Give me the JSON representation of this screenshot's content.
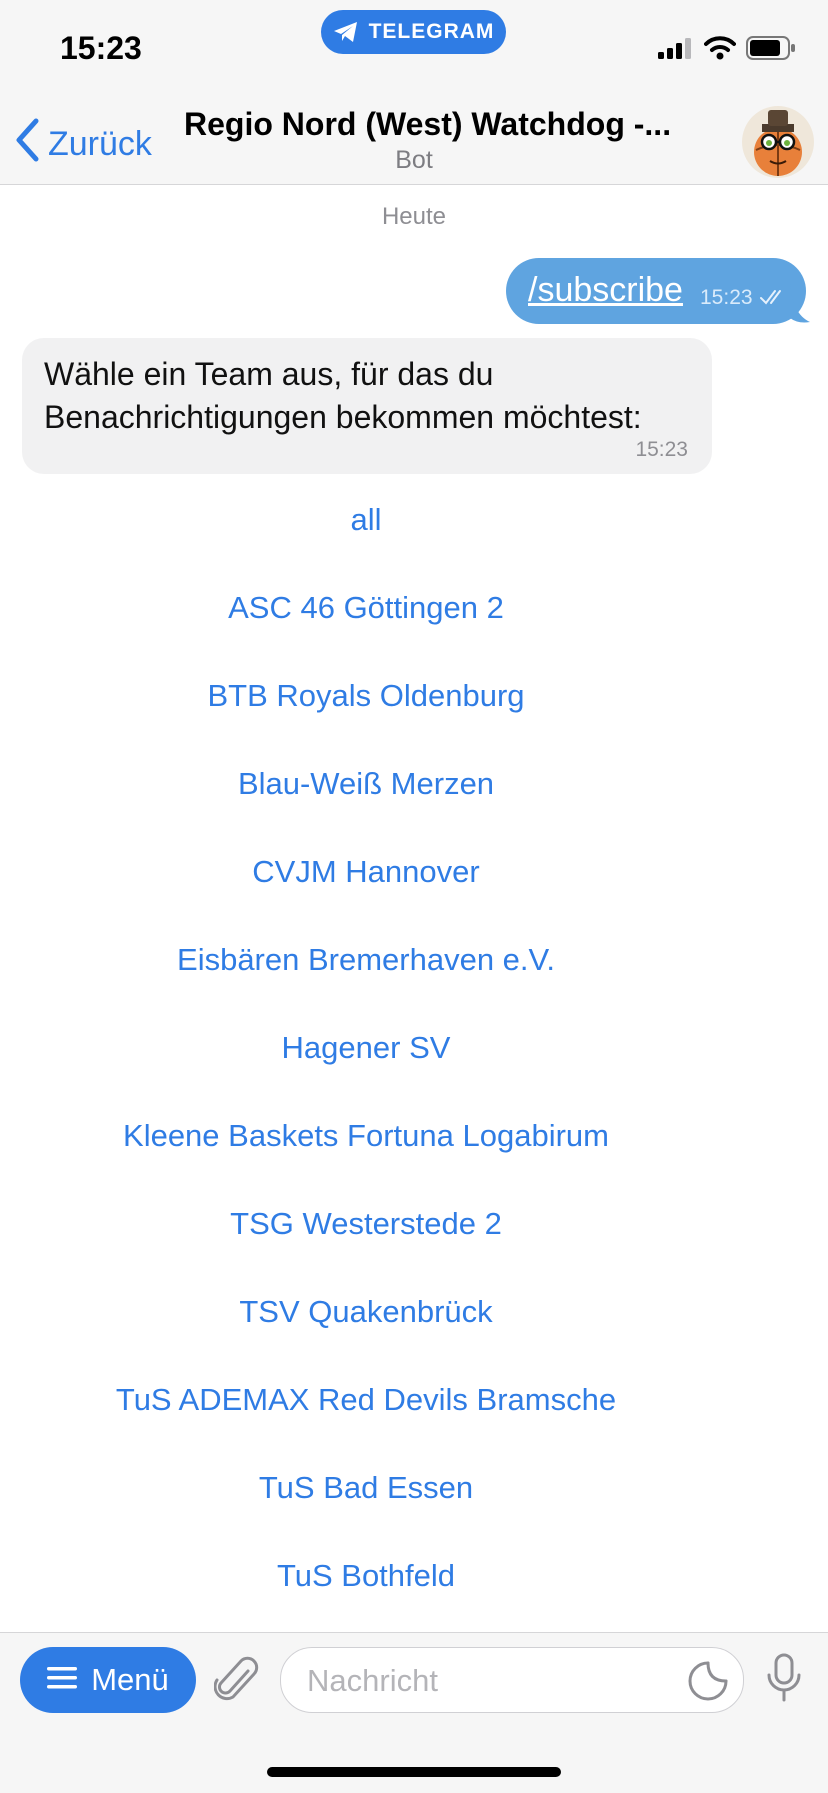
{
  "status_bar": {
    "time": "15:23",
    "app_pill": "TELEGRAM"
  },
  "header": {
    "back_label": "Zurück",
    "title": "Regio Nord (West) Watchdog -...",
    "subtitle": "Bot"
  },
  "chat": {
    "date_separator": "Heute",
    "outgoing": {
      "text": "/subscribe",
      "time": "15:23"
    },
    "incoming": {
      "text": "Wähle ein Team aus, für das du Benachrichtigungen bekommen möchtest:",
      "time": "15:23"
    }
  },
  "keyboard": [
    "all",
    "ASC 46 Göttingen 2",
    "BTB Royals Oldenburg",
    "Blau-Weiß Merzen",
    "CVJM Hannover",
    "Eisbären Bremerhaven e.V.",
    "Hagener SV",
    "Kleene Baskets Fortuna Logabirum",
    "TSG Westerstede 2",
    "TSV Quakenbrück",
    "TuS ADEMAX Red Devils Bramsche",
    "TuS Bad Essen",
    "TuS Bothfeld"
  ],
  "input_bar": {
    "menu_label": "Menü",
    "placeholder": "Nachricht"
  },
  "colors": {
    "accent": "#2f7ce4",
    "outgoing_bubble": "#5fa4e0",
    "incoming_bubble": "#f1f1f2"
  },
  "icons": [
    "telegram-plane-icon",
    "signal-icon",
    "wifi-icon",
    "battery-icon",
    "chevron-left-icon",
    "bot-avatar",
    "double-check-icon",
    "menu-icon",
    "paperclip-icon",
    "sticker-icon",
    "microphone-icon"
  ]
}
